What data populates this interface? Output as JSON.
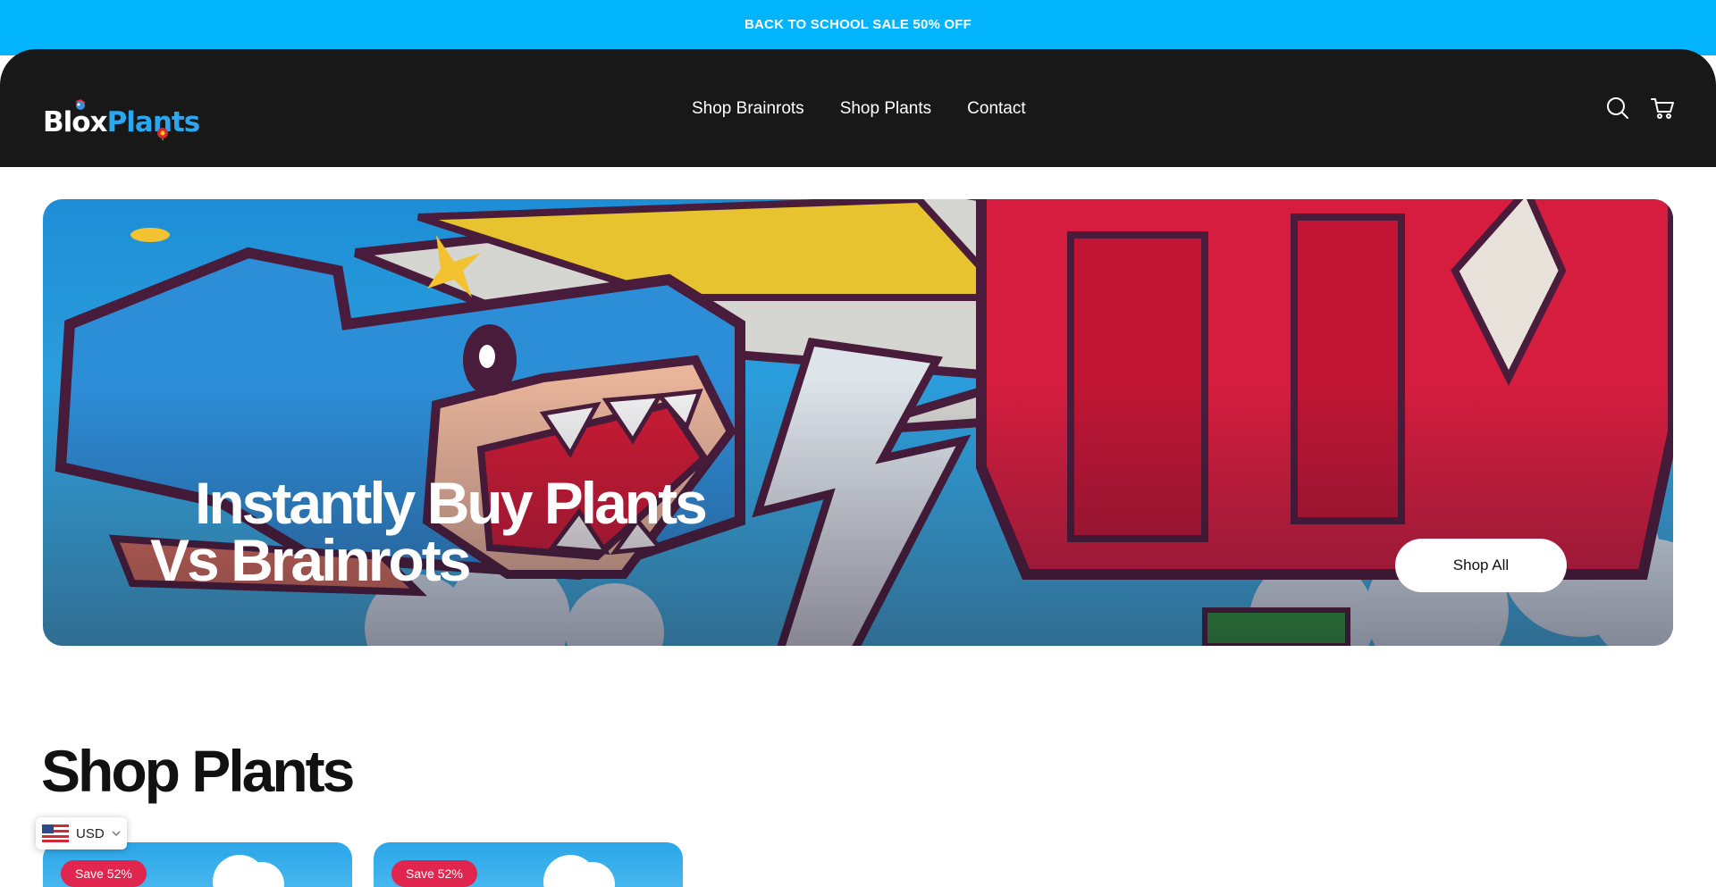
{
  "announcement": {
    "text": "BACK TO SCHOOL SALE 50% OFF"
  },
  "header": {
    "logo": {
      "part1": "Blox",
      "part2": "Plants"
    },
    "nav": [
      {
        "label": "Shop Brainrots"
      },
      {
        "label": "Shop Plants"
      },
      {
        "label": "Contact"
      }
    ],
    "icons": [
      "search-icon",
      "cart-icon"
    ]
  },
  "hero": {
    "title_line1": "Instantly Buy Plants",
    "title_line2": "Vs Brainrots",
    "button_label": "Shop All"
  },
  "section": {
    "title": "Shop Plants"
  },
  "products": [
    {
      "badge": "Save 52%"
    },
    {
      "badge": "Save 52%"
    }
  ],
  "currency": {
    "code": "USD",
    "flag": "us-flag-icon"
  },
  "colors": {
    "announcement_bg": "#02b4fb",
    "header_bg": "#181818",
    "logo_accent": "#2aa7ef",
    "badge_bg": "#e0254e"
  }
}
